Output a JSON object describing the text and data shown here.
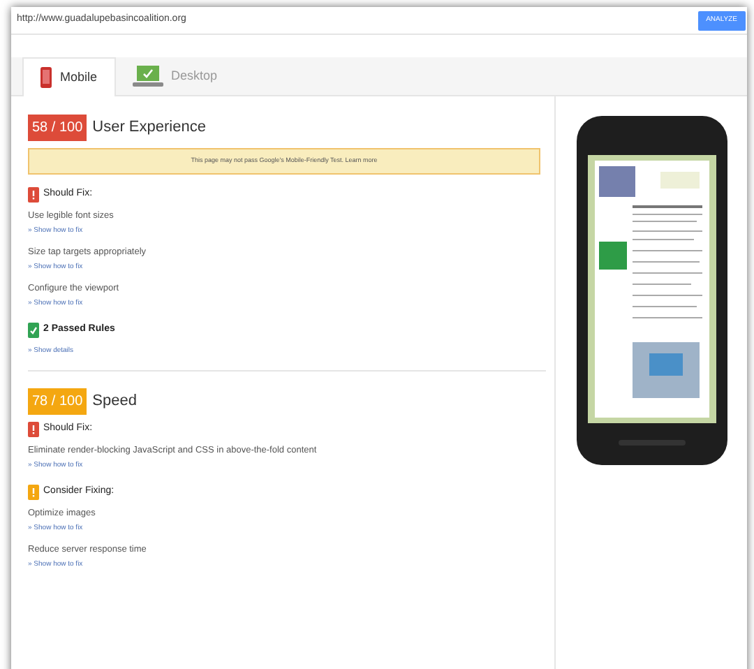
{
  "url_bar": {
    "value": "http://www.guadalupebasincoalition.org",
    "button": "ANALYZE"
  },
  "tabs": [
    {
      "label": "Mobile",
      "kind": "mobile",
      "selected": true
    },
    {
      "label": "Desktop",
      "kind": "desktop",
      "selected": false
    }
  ],
  "sections": [
    {
      "score": "58 / 100",
      "color": "#dd4b39",
      "title": "User Experience",
      "banner": "This page may not pass Google's Mobile-Friendly Test. Learn more",
      "groups": [
        {
          "kind": "should_fix",
          "heading": "Should Fix:",
          "rules": [
            {
              "name": "Use legible font sizes",
              "link": "» Show how to fix"
            },
            {
              "name": "Size tap targets appropriately",
              "link": "» Show how to fix"
            },
            {
              "name": "Configure the viewport",
              "link": "» Show how to fix"
            }
          ]
        },
        {
          "kind": "passed",
          "heading": "2 Passed Rules",
          "link": "» Show details"
        }
      ]
    },
    {
      "score": "78 / 100",
      "color": "#f4a711",
      "title": "Speed",
      "groups": [
        {
          "kind": "should_fix",
          "heading": "Should Fix:",
          "rules": [
            {
              "name": "Eliminate render-blocking JavaScript and CSS in above-the-fold content",
              "link": "» Show how to fix"
            }
          ]
        },
        {
          "kind": "consider",
          "heading": "Consider Fixing:",
          "rules": [
            {
              "name": "Optimize images",
              "link": "» Show how to fix"
            },
            {
              "name": "Reduce server response time",
              "link": "» Show how to fix"
            }
          ]
        }
      ]
    }
  ]
}
